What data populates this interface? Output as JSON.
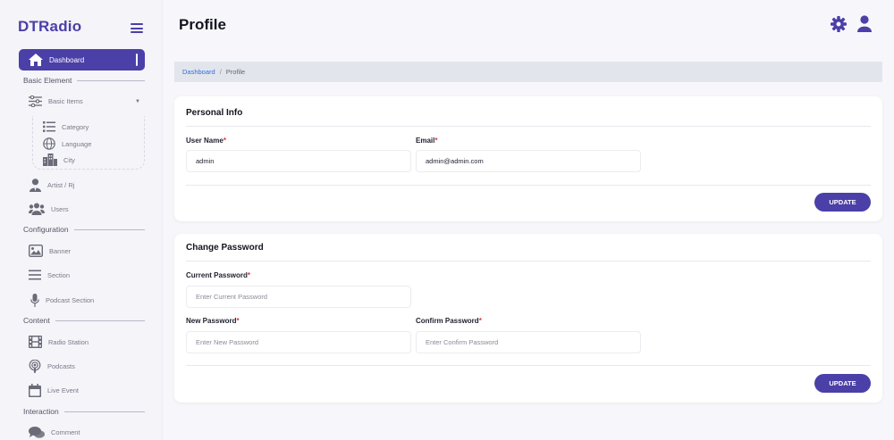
{
  "app": {
    "brand": "DTRadio"
  },
  "sidebar": {
    "active_item": {
      "label": "Dashboard",
      "icon": "home-icon"
    },
    "sections": {
      "basic": "Basic Element",
      "configuration": "Configuration",
      "content": "Content",
      "interaction": "Interaction"
    },
    "basic_items": {
      "label": "Basic Items",
      "icon": "sliders-icon"
    },
    "sub_items": [
      {
        "label": "Category",
        "icon": "list-icon"
      },
      {
        "label": "Language",
        "icon": "globe-icon"
      },
      {
        "label": "City",
        "icon": "building-icon"
      }
    ],
    "items": {
      "artist": {
        "label": "Artist / Rj",
        "icon": "user-tie-icon"
      },
      "users": {
        "label": "Users",
        "icon": "users-icon"
      },
      "banner": {
        "label": "Banner",
        "icon": "image-icon"
      },
      "section": {
        "label": "Section",
        "icon": "menu-icon"
      },
      "podcast_section": {
        "label": "Podcast Section",
        "icon": "microphone-icon"
      },
      "radio_station": {
        "label": "Radio Station",
        "icon": "film-icon"
      },
      "podcasts": {
        "label": "Podcasts",
        "icon": "podcast-icon"
      },
      "live_event": {
        "label": "Live Event",
        "icon": "calendar-icon"
      },
      "comment": {
        "label": "Comment",
        "icon": "comments-icon"
      }
    }
  },
  "header": {
    "title": "Profile"
  },
  "breadcrumb": {
    "home": "Dashboard",
    "separator": "/",
    "current": "Profile"
  },
  "personal_info": {
    "title": "Personal Info",
    "username_label": "User Name",
    "username_value": "admin",
    "email_label": "Email",
    "email_value": "admin@admin.com",
    "required_mark": "*",
    "update_label": "UPDATE"
  },
  "change_password": {
    "title": "Change Password",
    "current_label": "Current Password",
    "current_placeholder": "Enter Current Password",
    "new_label": "New Password",
    "new_placeholder": "Enter New Password",
    "confirm_label": "Confirm Password",
    "confirm_placeholder": "Enter Confirm Password",
    "required_mark": "*",
    "update_label": "UPDATE"
  },
  "colors": {
    "accent": "#4b3fa8",
    "required": "#d23b3b",
    "link": "#2f6fd6"
  }
}
